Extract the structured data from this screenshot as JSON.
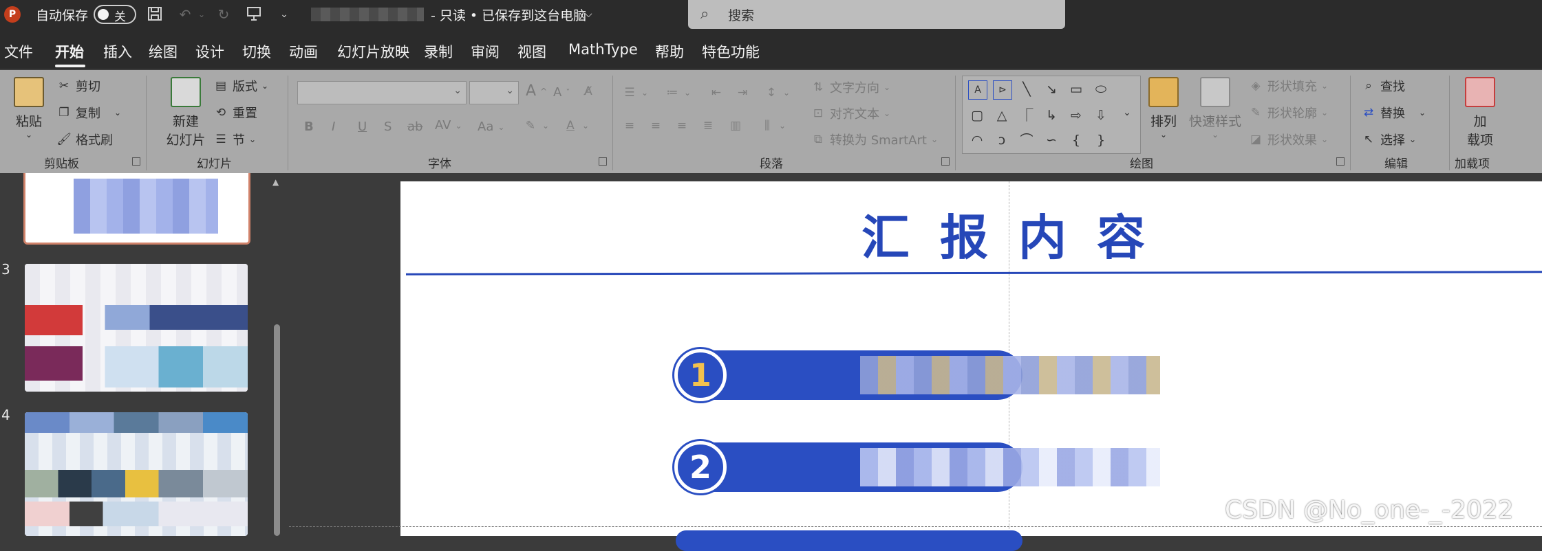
{
  "titlebar": {
    "app_icon_letter": "P",
    "autosave_label": "自动保存",
    "autosave_state": "关",
    "doc_status": "- 只读 • 已保存到这台电脑",
    "status_chevron": "⌵",
    "search_placeholder": "搜索"
  },
  "menu": {
    "tabs": [
      "文件",
      "开始",
      "插入",
      "绘图",
      "设计",
      "切换",
      "动画",
      "幻灯片放映",
      "录制",
      "审阅",
      "视图",
      "MathType",
      "帮助",
      "特色功能"
    ],
    "active_tab": "开始"
  },
  "ribbon": {
    "clipboard": {
      "paste": "粘贴",
      "cut": "剪切",
      "copy": "复制",
      "format_painter": "格式刷",
      "group": "剪贴板"
    },
    "slides": {
      "new_slide_line1": "新建",
      "new_slide_line2": "幻灯片",
      "layout": "版式",
      "reset": "重置",
      "section": "节",
      "group": "幻灯片"
    },
    "font": {
      "bold": "B",
      "italic": "I",
      "underline": "U",
      "shadow": "S",
      "strike": "ab",
      "spacing": "AV",
      "case": "Aa",
      "grow": "A",
      "shrink": "A",
      "group": "字体"
    },
    "paragraph": {
      "text_direction": "文字方向",
      "align_text": "对齐文本",
      "convert_smartart": "转换为 SmartArt",
      "group": "段落"
    },
    "drawing": {
      "arrange": "排列",
      "quick_styles": "快速样式",
      "shape_fill": "形状填充",
      "shape_outline": "形状轮廓",
      "shape_effects": "形状效果",
      "group": "绘图"
    },
    "editing": {
      "find": "查找",
      "replace": "替换",
      "select": "选择",
      "group": "编辑"
    },
    "addins": {
      "addins_line1": "加",
      "addins_line2": "载项",
      "group": "加载项"
    }
  },
  "slides_pane": {
    "slide_numbers": [
      "3",
      "4"
    ]
  },
  "slide": {
    "title": "汇报内容",
    "items": [
      {
        "number": "1"
      },
      {
        "number": "2"
      }
    ]
  },
  "watermark": "CSDN @No_one-_-2022",
  "colors": {
    "slide_blue": "#2a4ec2",
    "number_one": "#f2c14e",
    "number_two": "#ffffff"
  }
}
